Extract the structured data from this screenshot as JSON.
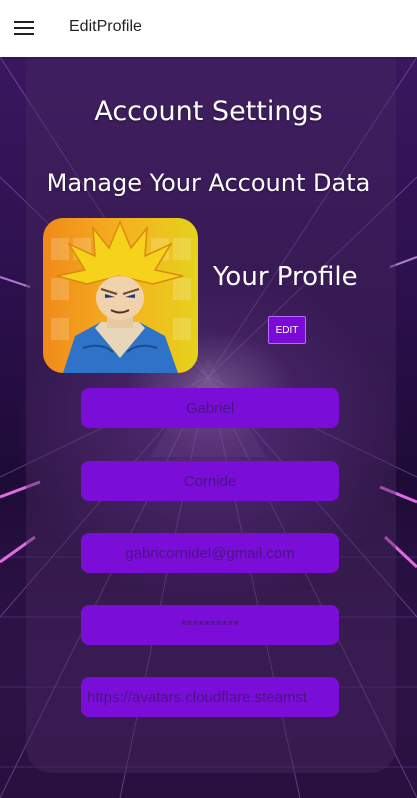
{
  "appbar": {
    "title": "EditProfile",
    "menu_icon": "hamburger-menu-icon"
  },
  "page": {
    "title": "Account Settings",
    "subtitle": "Manage Your Account Data"
  },
  "profile": {
    "label": "Your Profile",
    "edit_label": "EDIT",
    "avatar_icon": "profile-avatar-image"
  },
  "form": {
    "first_name": "Gabriel",
    "last_name": "Cornide",
    "email": "gabricornidel@gmail.com",
    "password": "**********",
    "avatar_url": "https://avatars.cloudflare.steamst"
  },
  "colors": {
    "appbar_bg": "#ffffff",
    "field_bg": "#7a0ed8",
    "field_text": "#4a1582",
    "button_bg": "#7b0ad6",
    "text_on_dark": "#ffffff"
  }
}
